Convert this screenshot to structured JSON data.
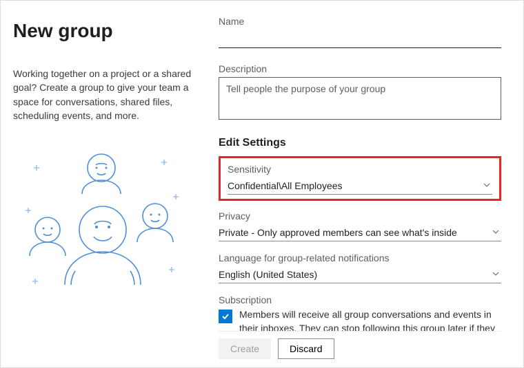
{
  "left": {
    "title": "New group",
    "intro": "Working together on a project or a shared goal? Create a group to give your team a space for conversations, shared files, scheduling events, and more."
  },
  "form": {
    "name": {
      "label": "Name",
      "value": ""
    },
    "description": {
      "label": "Description",
      "placeholder": "Tell people the purpose of your group",
      "value": ""
    },
    "settings_heading": "Edit Settings",
    "sensitivity": {
      "label": "Sensitivity",
      "value": "Confidential\\All Employees"
    },
    "privacy": {
      "label": "Privacy",
      "value": "Private - Only approved members can see what's inside"
    },
    "language": {
      "label": "Language for group-related notifications",
      "value": "English (United States)"
    },
    "subscription": {
      "label": "Subscription",
      "checked": true,
      "text": "Members will receive all group conversations and events in their inboxes. They can stop following this group later if they"
    }
  },
  "buttons": {
    "create": "Create",
    "discard": "Discard"
  }
}
